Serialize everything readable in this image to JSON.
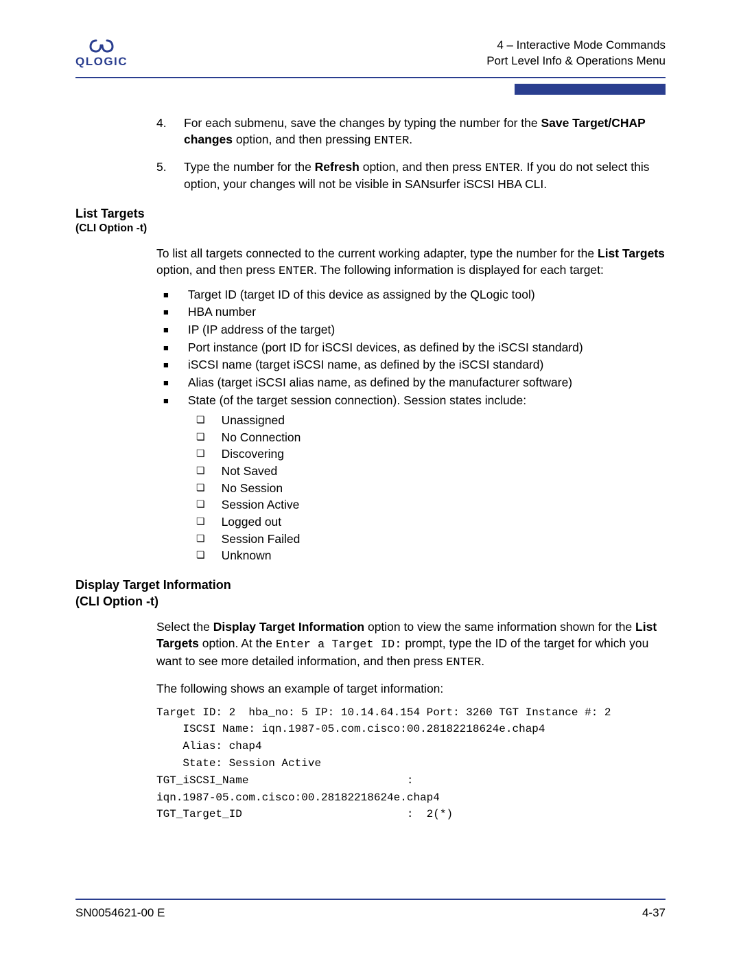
{
  "header": {
    "logo_text": "QLOGIC",
    "line1": "4 – Interactive Mode Commands",
    "line2": "Port Level Info & Operations Menu"
  },
  "steps": {
    "s4": {
      "num": "4.",
      "t1": "For each submenu, save the changes by typing the number for the ",
      "b1": "Save Target/CHAP changes",
      "t2": " option, and then pressing ",
      "m1": "ENTER",
      "t3": "."
    },
    "s5": {
      "num": "5.",
      "t1": "Type the number for the ",
      "b1": "Refresh",
      "t2": " option, and then press ",
      "m1": "ENTER",
      "t3": ". If you do not select this option, your changes will not be visible in SANsurfer iSCSI HBA CLI."
    }
  },
  "list_targets": {
    "title": "List Targets",
    "subtitle": "(CLI Option -t)",
    "intro_t1": "To list all targets connected to the current working adapter, type the number for the ",
    "intro_b1": "List Targets",
    "intro_t2": " option, and then press ",
    "intro_m1": "ENTER",
    "intro_t3": ". The following information is displayed for each target:",
    "items": [
      "Target ID (target ID of this device as assigned by the QLogic tool)",
      "HBA number",
      "IP (IP address of the target)",
      "Port instance (port ID for iSCSI devices, as defined by the iSCSI standard)",
      "iSCSI name (target iSCSI name, as defined by the iSCSI standard)",
      "Alias (target iSCSI alias name, as defined by the manufacturer software)",
      "State (of the target session connection). Session states include:"
    ],
    "states": [
      "Unassigned",
      "No Connection",
      "Discovering",
      "Not Saved",
      "No Session",
      "Session Active",
      "Logged out",
      "Session Failed",
      "Unknown"
    ]
  },
  "display_target": {
    "title1": "Display Target Information",
    "title2": "(CLI Option -t)",
    "p1_t1": "Select the ",
    "p1_b1": "Display Target Information",
    "p1_t2": " option to view the same information shown for the ",
    "p1_b2": "List Targets",
    "p1_t3": " option. At the ",
    "p1_m1": "Enter a Target ID:",
    "p1_t4": " prompt, type the ID of the target for which you want to see more detailed information, and then press ",
    "p1_m2": "ENTER",
    "p1_t5": ".",
    "p2": "The following shows an example of target information:",
    "code": "Target ID: 2  hba_no: 5 IP: 10.14.64.154 Port: 3260 TGT Instance #: 2\n    ISCSI Name: iqn.1987-05.com.cisco:00.28182218624e.chap4\n    Alias: chap4\n    State: Session Active\nTGT_iSCSI_Name                        :  \niqn.1987-05.com.cisco:00.28182218624e.chap4\nTGT_Target_ID                         :  2(*)"
  },
  "footer": {
    "left": "SN0054621-00 E",
    "right": "4-37"
  }
}
